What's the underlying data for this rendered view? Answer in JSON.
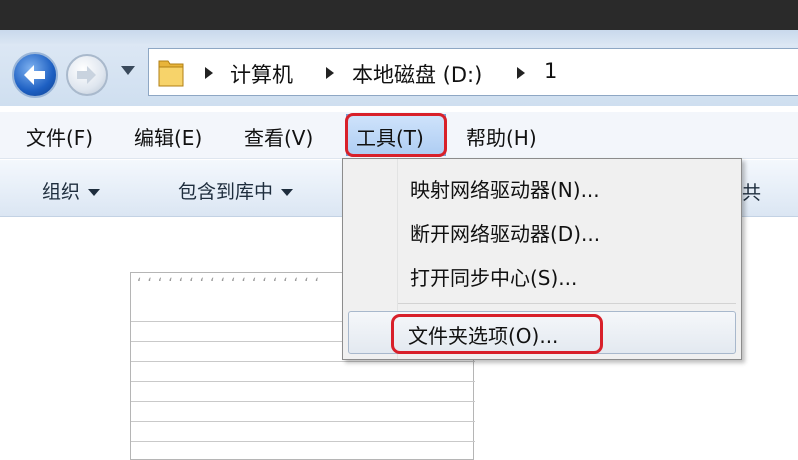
{
  "address": {
    "crumbs": [
      "计算机",
      "本地磁盘 (D:)",
      "1"
    ]
  },
  "menu_bar": {
    "items": [
      "文件(F)",
      "编辑(E)",
      "查看(V)",
      "工具(T)",
      "帮助(H)"
    ],
    "active": "工具(T)"
  },
  "toolbar": {
    "organize": "组织",
    "include_in_library": "包含到库中",
    "clipped": "共"
  },
  "tools_menu": {
    "items": [
      "映射网络驱动器(N)...",
      "断开网络驱动器(D)...",
      "打开同步中心(S)...",
      "文件夹选项(O)..."
    ],
    "highlighted": "文件夹选项(O)..."
  },
  "colors": {
    "highlight_red": "#d8202a",
    "accent_blue": "#1d5fc2"
  },
  "icons": [
    "back-arrow-icon",
    "forward-arrow-icon",
    "history-dropdown-icon",
    "folder-icon",
    "breadcrumb-arrow-icon",
    "caret-down-icon"
  ]
}
